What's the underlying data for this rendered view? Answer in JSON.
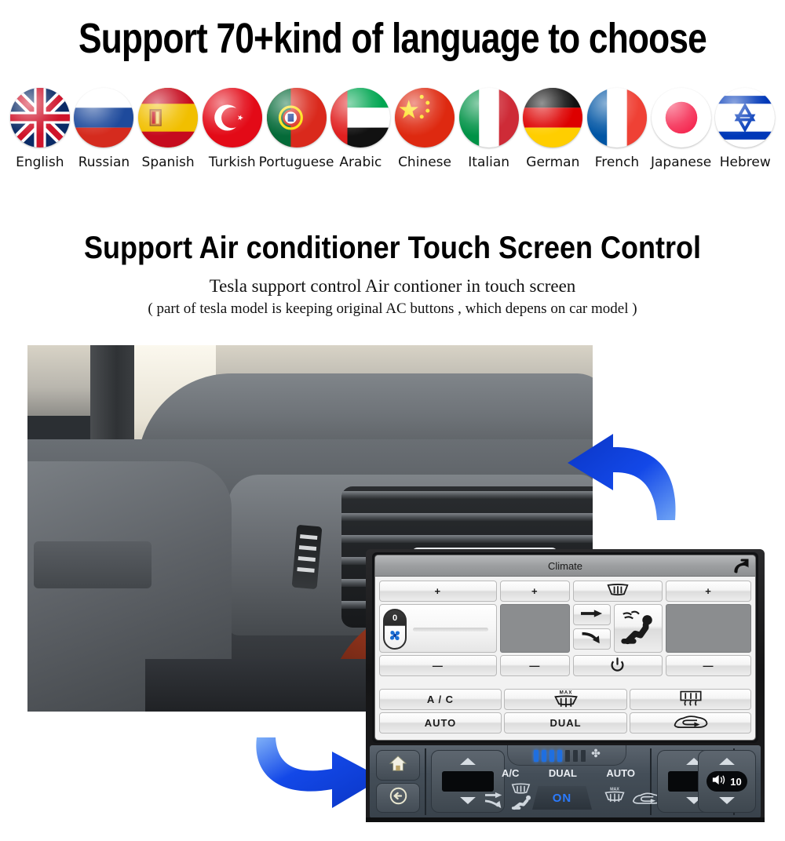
{
  "headings": {
    "language_title": "Support 70+kind of  language to choose",
    "ac_title": "Support Air conditioner Touch Screen Control",
    "ac_sub1": "Tesla support control Air contioner in touch screen",
    "ac_sub2": "( part of tesla model is keeping original AC buttons , which depens on car model )"
  },
  "languages": [
    {
      "label": "English",
      "flag": "uk-flag-icon"
    },
    {
      "label": "Russian",
      "flag": "russia-flag-icon"
    },
    {
      "label": "Spanish",
      "flag": "spain-flag-icon"
    },
    {
      "label": "Turkish",
      "flag": "turkey-flag-icon"
    },
    {
      "label": "Portuguese",
      "flag": "portugal-flag-icon"
    },
    {
      "label": "Arabic",
      "flag": "uae-flag-icon"
    },
    {
      "label": "Chinese",
      "flag": "china-flag-icon"
    },
    {
      "label": "Italian",
      "flag": "italy-flag-icon"
    },
    {
      "label": "German",
      "flag": "germany-flag-icon"
    },
    {
      "label": "French",
      "flag": "france-flag-icon"
    },
    {
      "label": "Japanese",
      "flag": "japan-flag-icon"
    },
    {
      "label": "Hebrew",
      "flag": "israel-flag-icon"
    }
  ],
  "photo": {
    "alt": "car dashboard air vent close-up"
  },
  "arrows": {
    "top_arrow": "curved-arrow-left-icon",
    "bottom_arrow": "curved-arrow-right-icon",
    "color": "#1348e8"
  },
  "climate_screen": {
    "title": "Climate",
    "back_icon": "back-arrow-icon",
    "row_top": [
      {
        "name": "driver-temp-up",
        "label": "+"
      },
      {
        "name": "fan-speed-up",
        "label": "+"
      },
      {
        "name": "front-defrost",
        "icon": "front-defrost-icon",
        "label": ""
      },
      {
        "name": "passenger-temp-up",
        "label": "+"
      }
    ],
    "fan_slider": {
      "value": "0",
      "icon": "fan-icon"
    },
    "airflow": {
      "face_vent": "arrow-right-icon",
      "floor_vent": "arrow-down-curve-icon",
      "seat_airflow": "seat-airflow-icon"
    },
    "power_icon": "power-icon",
    "row_bottom": [
      {
        "name": "driver-temp-down",
        "label": "—"
      },
      {
        "name": "fan-speed-down",
        "label": "—"
      },
      {
        "name": "power",
        "label": ""
      },
      {
        "name": "passenger-temp-down",
        "label": "—"
      }
    ],
    "row_ac": [
      {
        "name": "ac-button",
        "label": "A / C",
        "icon": ""
      },
      {
        "name": "max-defrost-button",
        "label": "",
        "icon": "max-defrost-icon",
        "badge": "MAX"
      },
      {
        "name": "rear-defrost-button",
        "label": "",
        "icon": "rear-defrost-icon"
      }
    ],
    "row_auto": [
      {
        "name": "auto-button",
        "label": "AUTO",
        "icon": ""
      },
      {
        "name": "dual-button",
        "label": "DUAL",
        "icon": ""
      },
      {
        "name": "recirculate-button",
        "label": "",
        "icon": "recirculate-icon"
      }
    ]
  },
  "hardware_bar": {
    "home_icon": "home-icon",
    "back_icon": "back-circle-icon",
    "left_rocker": {
      "up": "chevron-up-icon",
      "down": "chevron-down-icon",
      "display": ""
    },
    "right_rocker": {
      "up": "chevron-up-icon",
      "down": "chevron-down-icon",
      "display": ""
    },
    "fan_indicator": {
      "segments_total": 8,
      "segments_lit": 4,
      "icon": "fan-icon"
    },
    "labels": [
      "A/C",
      "DUAL",
      "AUTO"
    ],
    "on_label": "ON",
    "icons": {
      "defrost": "front-defrost-icon",
      "airflow_arrows": "airflow-arrows-icon",
      "seat_airflow": "seat-airflow-icon",
      "max_defrost": "max-defrost-icon",
      "max_badge": "MAX",
      "recirculate": "recirculate-icon"
    },
    "volume": {
      "icon": "volume-icon",
      "value": "10",
      "up": "chevron-up-icon",
      "down": "chevron-down-icon"
    }
  },
  "colors": {
    "accent_blue": "#1348e8",
    "on_blue": "#2b7bff",
    "fan_blue": "#1f6fe0",
    "screen_bg": "#f2f2f2",
    "titlebar": "#9d9fa1"
  }
}
